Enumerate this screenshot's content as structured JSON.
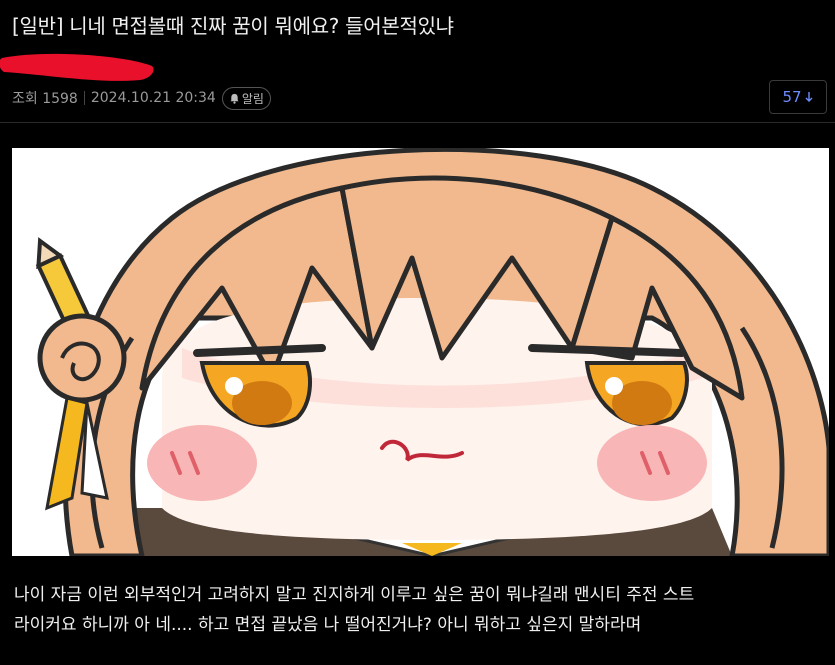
{
  "post": {
    "title": "[일반] 니네 면접볼때 진짜 꿈이 뭐에요? 들어본적있냐",
    "views_label": "조회 1598",
    "date": "2024.10.21 20:34",
    "alarm_label": "알림",
    "comment_count": "57",
    "body_lines": [
      "나이 자금 이런 외부적인거 고려하지 말고 진지하게 이루고 싶은 꿈이 뭐냐길래 맨시티 주전 스트",
      "라이커요 하니까 아 네.... 하고 면접 끝났음 나 떨어진거냐? 아니 뭐하고 싶은지 말하라며"
    ]
  },
  "colors": {
    "background": "#000000",
    "accent": "#6f8cff",
    "redaction": "#e8102a"
  },
  "icons": {
    "alarm": "bell-icon",
    "comment_arrow": "arrow-down-icon"
  }
}
